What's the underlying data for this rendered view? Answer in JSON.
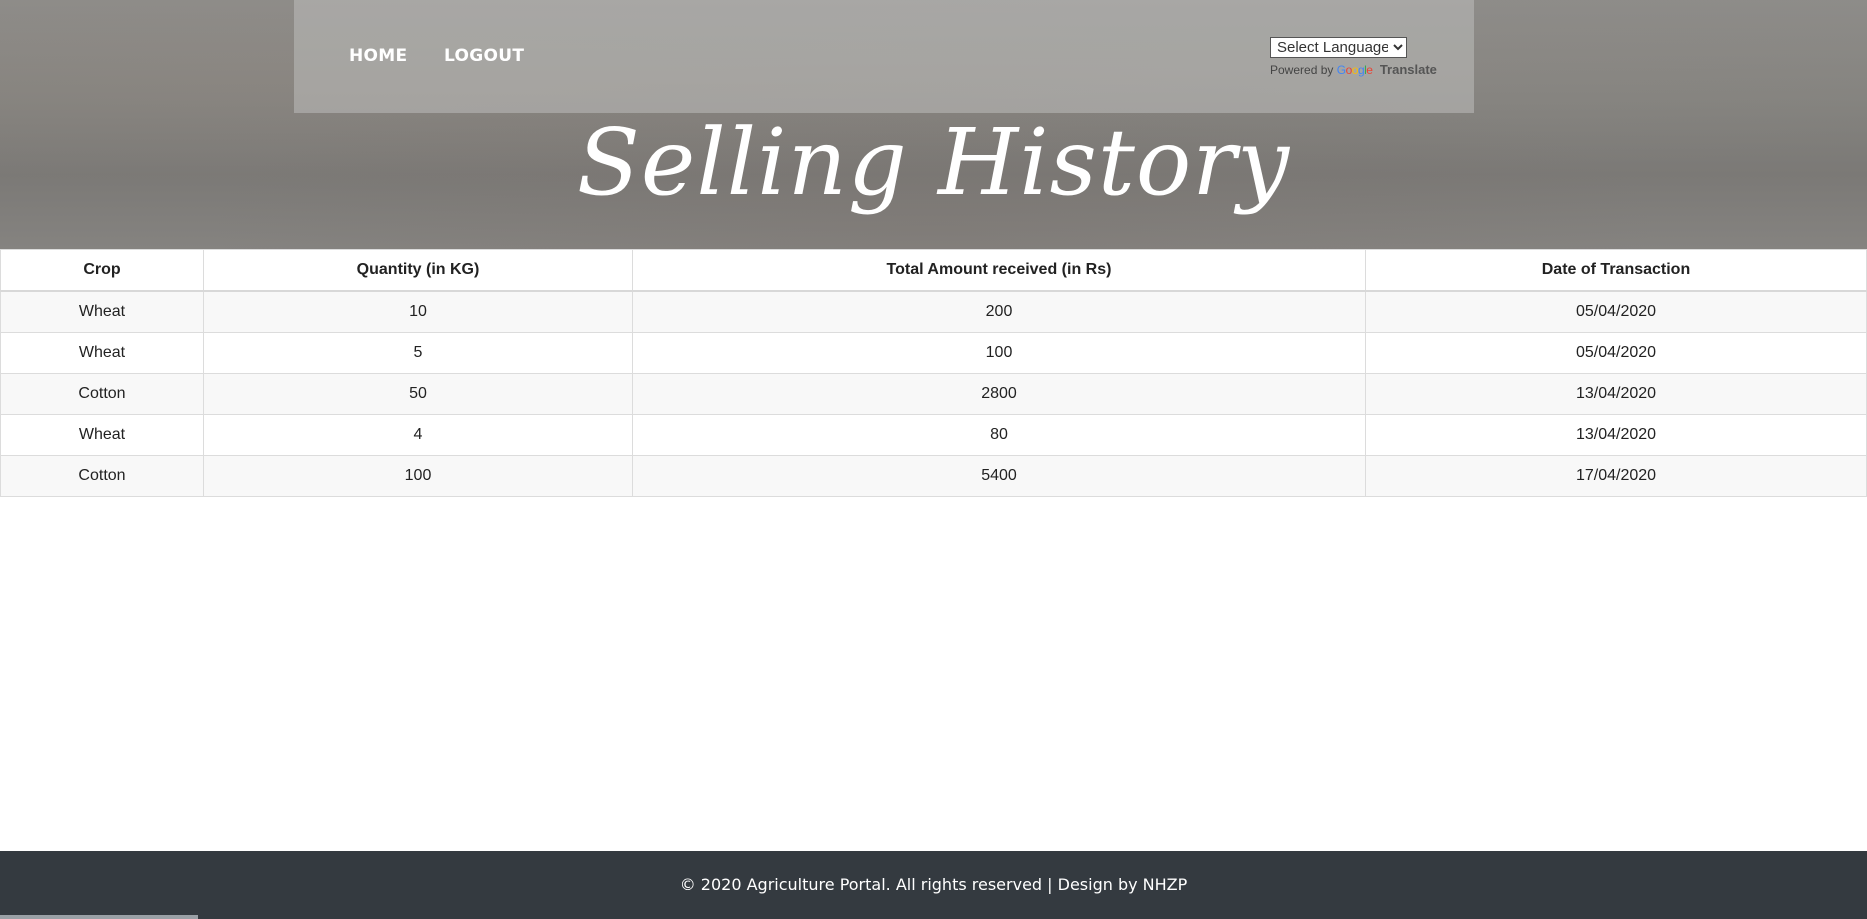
{
  "nav": {
    "home_label": "HOME",
    "logout_label": "LOGOUT"
  },
  "translate": {
    "select_label": "Select Language",
    "powered_by": "Powered by",
    "translate_label": "Translate"
  },
  "page_title": "Selling History",
  "table": {
    "headers": [
      "Crop",
      "Quantity (in KG)",
      "Total Amount received (in Rs)",
      "Date of Transaction"
    ],
    "rows": [
      [
        "Wheat",
        "10",
        "200",
        "05/04/2020"
      ],
      [
        "Wheat",
        "5",
        "100",
        "05/04/2020"
      ],
      [
        "Cotton",
        "50",
        "2800",
        "13/04/2020"
      ],
      [
        "Wheat",
        "4",
        "80",
        "13/04/2020"
      ],
      [
        "Cotton",
        "100",
        "5400",
        "17/04/2020"
      ]
    ]
  },
  "footer": {
    "copyright": "© 2020 Agriculture Portal. All rights reserved | Design by",
    "designer": "NHZP"
  },
  "colors": {
    "footer_bg": "#343a40",
    "navbar_bg": "rgba(190,190,188,0.55)"
  }
}
